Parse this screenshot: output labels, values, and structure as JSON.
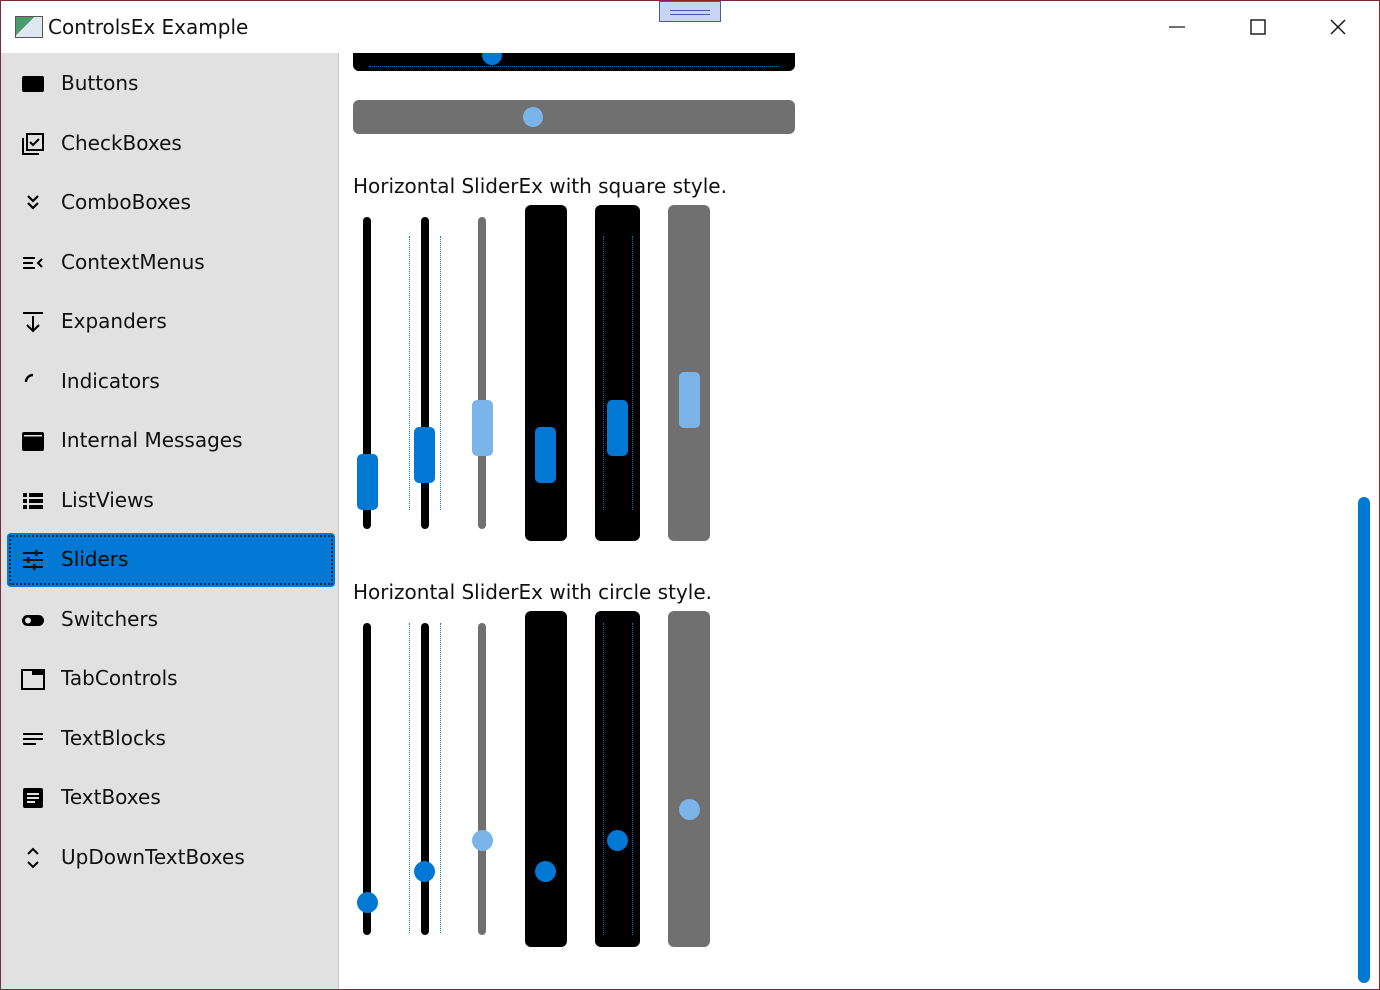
{
  "window": {
    "title": "ControlsEx Example"
  },
  "titlebar": {
    "minimize": "minimize",
    "maximize": "maximize",
    "close": "close"
  },
  "sidebar": {
    "items": [
      {
        "label": "Buttons",
        "icon": "button-icon"
      },
      {
        "label": "CheckBoxes",
        "icon": "checkbox-icon"
      },
      {
        "label": "ComboBoxes",
        "icon": "chevron-double-down-icon"
      },
      {
        "label": "ContextMenus",
        "icon": "menu-open-icon"
      },
      {
        "label": "Expanders",
        "icon": "arrow-collapse-down-icon"
      },
      {
        "label": "Indicators",
        "icon": "loading-arc-icon"
      },
      {
        "label": "Internal Messages",
        "icon": "message-window-icon"
      },
      {
        "label": "ListViews",
        "icon": "list-icon"
      },
      {
        "label": "Sliders",
        "icon": "tune-icon",
        "selected": true
      },
      {
        "label": "Switchers",
        "icon": "toggle-icon"
      },
      {
        "label": "TabControls",
        "icon": "tab-icon"
      },
      {
        "label": "TextBlocks",
        "icon": "text-lines-icon"
      },
      {
        "label": "TextBoxes",
        "icon": "text-box-icon"
      },
      {
        "label": "UpDownTextBoxes",
        "icon": "unfold-icon"
      }
    ]
  },
  "content": {
    "square_section_title": "Horizontal SliderEx with square style.",
    "circle_section_title": "Horizontal SliderEx with circle style.",
    "square_slider_values": [
      0.18,
      0.25,
      0.33,
      0.27,
      0.36,
      0.43
    ],
    "circle_slider_values": [
      0.1,
      0.2,
      0.3,
      0.22,
      0.32,
      0.42
    ],
    "colors": {
      "accent": "#0078d4",
      "accent_light": "#7ab4e8",
      "track_gray": "#707070",
      "track_black": "#000000",
      "sidebar_bg": "#e1e1e1"
    }
  }
}
